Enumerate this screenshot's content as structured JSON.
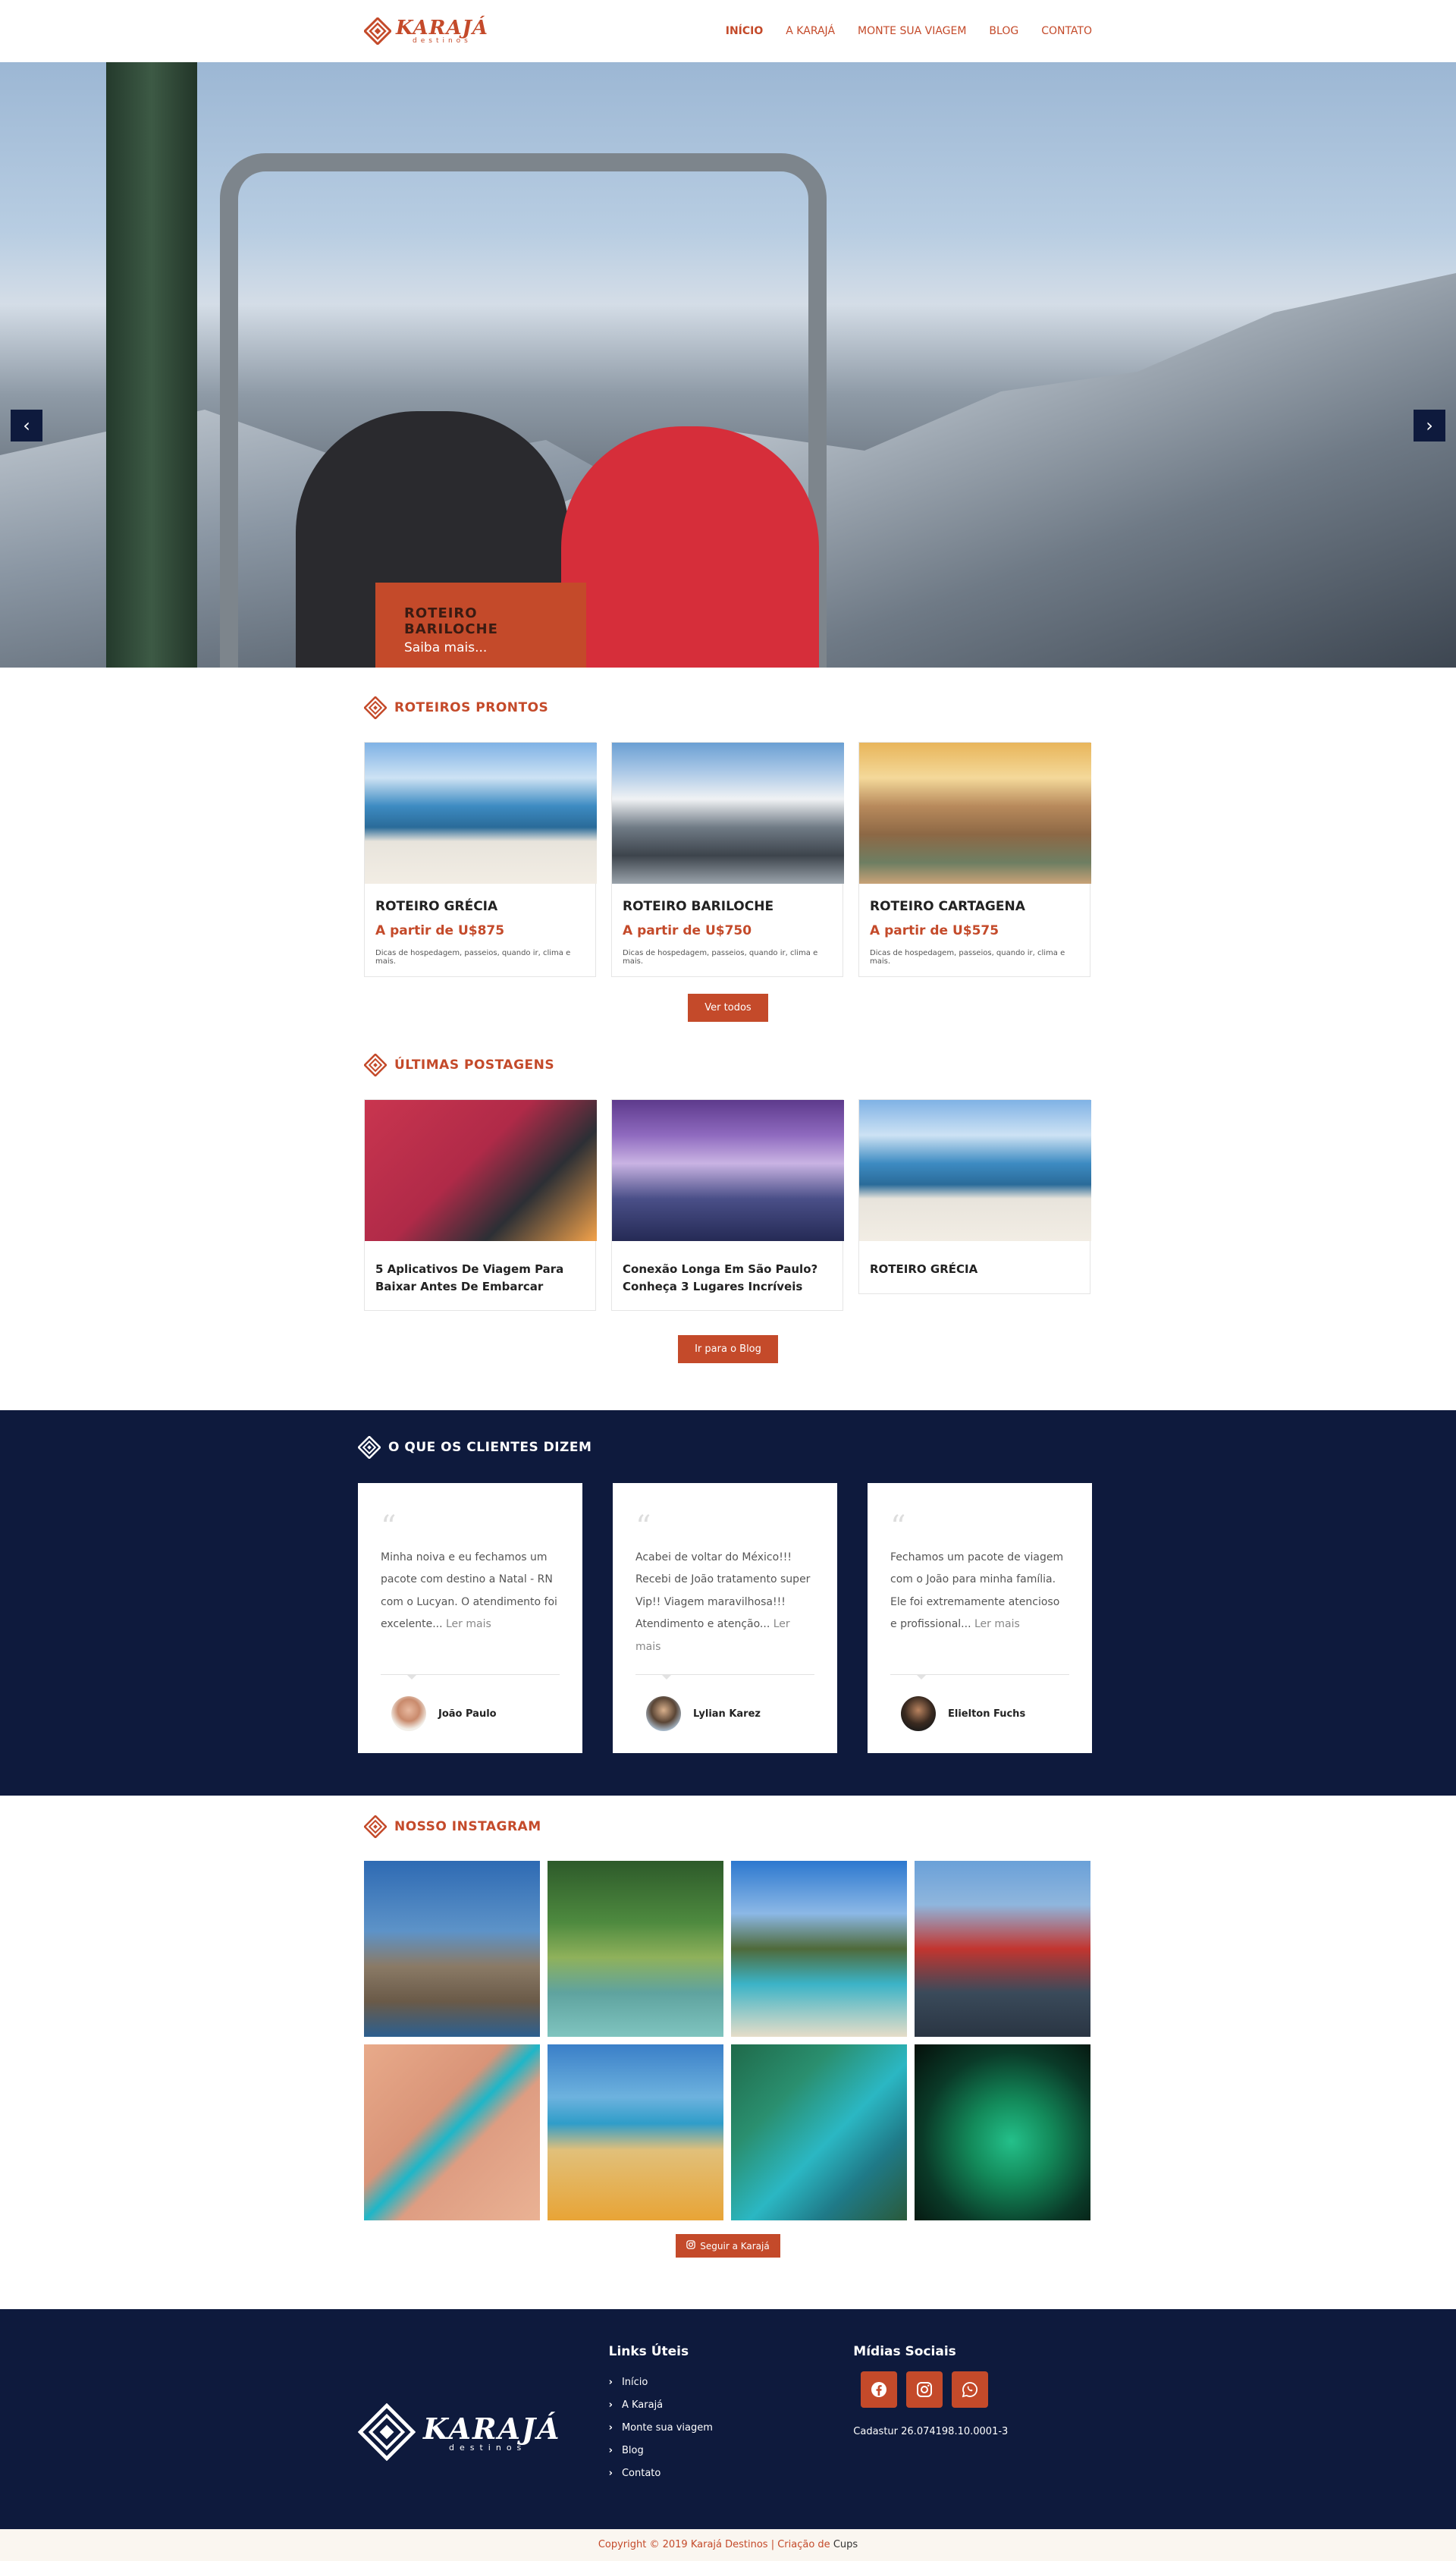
{
  "brand": {
    "name": "KARAJÁ",
    "sub": "destinos",
    "accent": "#c44a2a",
    "navy": "#0e1a3d"
  },
  "nav": {
    "items": [
      {
        "label": "INÍCIO",
        "active": true
      },
      {
        "label": "A KARAJÁ"
      },
      {
        "label": "MONTE SUA VIAGEM"
      },
      {
        "label": "BLOG"
      },
      {
        "label": "CONTATO"
      }
    ]
  },
  "hero": {
    "caption_title": "ROTEIRO BARILOCHE",
    "caption_link": "Saiba mais...",
    "prev_icon": "chevron-left-icon",
    "next_icon": "chevron-right-icon"
  },
  "roteiros": {
    "title": "ROTEIROS PRONTOS",
    "cards": [
      {
        "name": "ROTEIRO GRÉCIA",
        "price": "A partir de U$875",
        "desc": "Dicas de hospedagem, passeios, quando ir, clima e mais."
      },
      {
        "name": "ROTEIRO BARILOCHE",
        "price": "A partir de U$750",
        "desc": "Dicas de hospedagem, passeios, quando ir, clima e mais."
      },
      {
        "name": "ROTEIRO CARTAGENA",
        "price": "A partir de U$575",
        "desc": "Dicas de hospedagem, passeios, quando ir, clima e mais."
      }
    ],
    "button": "Ver todos"
  },
  "posts": {
    "title": "ÚLTIMAS POSTAGENS",
    "items": [
      {
        "title": "5 Aplicativos De Viagem Para Baixar Antes De Embarcar"
      },
      {
        "title": "Conexão Longa Em São Paulo? Conheça 3 Lugares Incríveis"
      },
      {
        "title": "ROTEIRO GRÉCIA"
      }
    ],
    "button": "Ir para o Blog"
  },
  "testimonials": {
    "title": "O QUE OS CLIENTES DIZEM",
    "items": [
      {
        "text": "Minha noiva e eu fechamos um pacote com destino a Natal - RN com o Lucyan. O atendimento foi excelente...",
        "more": "Ler mais",
        "name": "João Paulo"
      },
      {
        "text": "Acabei de voltar do México!!! Recebi de João tratamento super Vip!! Viagem maravilhosa!!! Atendimento e atenção...",
        "more": "Ler mais",
        "name": "Lylian Karez"
      },
      {
        "text": "Fechamos um pacote de viagem com o João para minha família. Ele foi extremamente atencioso e profissional...",
        "more": "Ler mais",
        "name": "Elielton Fuchs"
      }
    ]
  },
  "instagram": {
    "title": "NOSSO INSTAGRAM",
    "button": "Seguir a Karajá"
  },
  "footer": {
    "links_title": "Links Úteis",
    "links": [
      "Início",
      "A Karajá",
      "Monte sua viagem",
      "Blog",
      "Contato"
    ],
    "social_title": "Mídias Sociais",
    "social_icons": [
      "facebook-icon",
      "instagram-icon",
      "whatsapp-icon"
    ],
    "cadastur": "Cadastur 26.074198.10.0001-3",
    "copyright": "Copyright © 2019 Karajá Destinos | Criação de",
    "credit": "Cups"
  }
}
